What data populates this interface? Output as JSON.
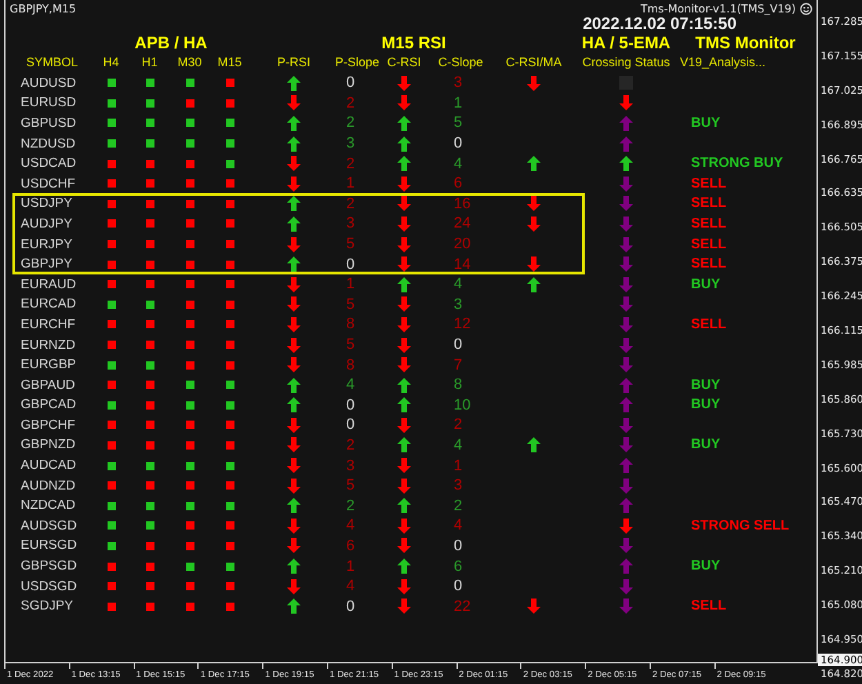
{
  "chart": {
    "symbol_timeframe": "GBPJPY,M15",
    "indicator": "Tms-Monitor-v1.1(TMS_V19)",
    "timestamp": "2022.12.02 07:15:50"
  },
  "group_headers": [
    {
      "label": "APB / HA",
      "kind": "apb"
    },
    {
      "label": "M15 RSI",
      "kind": "rsi"
    },
    {
      "label": "HA / 5-EMA",
      "kind": "ema"
    },
    {
      "label": "TMS Monitor",
      "kind": "tms"
    }
  ],
  "columns": [
    "SYMBOL",
    "H4",
    "H1",
    "M30",
    "M15",
    "P-RSI",
    "P-Slope",
    "C-RSI",
    "C-Slope",
    "C-RSI/MA",
    "Crossing Status",
    "V19_Analysis..."
  ],
  "rows": [
    {
      "symbol": "AUDUSD",
      "tf_up": [
        true,
        true,
        true,
        false
      ],
      "p_rsi_up": true,
      "p_slope": {
        "value": "0",
        "color": "#d8d8d8"
      },
      "c_rsi_up": false,
      "c_slope": {
        "value": "3",
        "color": "#b00000"
      },
      "c_rsi_ma": {
        "up": false
      },
      "crossing": {
        "kind": "box",
        "color": "#262626"
      },
      "highlighted": false
    },
    {
      "symbol": "EURUSD",
      "tf_up": [
        true,
        true,
        false,
        false
      ],
      "p_rsi_up": false,
      "p_slope": {
        "value": "2",
        "color": "#b00000"
      },
      "c_rsi_up": false,
      "c_slope": {
        "value": "1",
        "color": "#2a9a2a"
      },
      "crossing": {
        "kind": "arrow",
        "up": false,
        "color": "#ff0000"
      },
      "highlighted": false
    },
    {
      "symbol": "GBPUSD",
      "tf_up": [
        true,
        true,
        true,
        true
      ],
      "p_rsi_up": true,
      "p_slope": {
        "value": "2",
        "color": "#2a9a2a"
      },
      "c_rsi_up": true,
      "c_slope": {
        "value": "5",
        "color": "#2a9a2a"
      },
      "crossing": {
        "kind": "arrow",
        "up": true,
        "color": "#800080"
      },
      "signal": {
        "text": "BUY",
        "color": "#22c722"
      },
      "highlighted": false
    },
    {
      "symbol": "NZDUSD",
      "tf_up": [
        true,
        true,
        true,
        true
      ],
      "p_rsi_up": true,
      "p_slope": {
        "value": "3",
        "color": "#2a9a2a"
      },
      "c_rsi_up": true,
      "c_slope": {
        "value": "0",
        "color": "#d8d8d8"
      },
      "crossing": {
        "kind": "arrow",
        "up": true,
        "color": "#800080"
      },
      "highlighted": false
    },
    {
      "symbol": "USDCAD",
      "tf_up": [
        false,
        false,
        false,
        true
      ],
      "p_rsi_up": false,
      "p_slope": {
        "value": "2",
        "color": "#b00000"
      },
      "c_rsi_up": true,
      "c_slope": {
        "value": "4",
        "color": "#2a9a2a"
      },
      "c_rsi_ma": {
        "up": true
      },
      "crossing": {
        "kind": "arrow",
        "up": true,
        "color": "#22c722"
      },
      "signal": {
        "text": "STRONG BUY",
        "color": "#22c722"
      },
      "highlighted": false
    },
    {
      "symbol": "USDCHF",
      "tf_up": [
        false,
        false,
        false,
        false
      ],
      "p_rsi_up": false,
      "p_slope": {
        "value": "1",
        "color": "#b00000"
      },
      "c_rsi_up": false,
      "c_slope": {
        "value": "6",
        "color": "#b00000"
      },
      "crossing": {
        "kind": "arrow",
        "up": false,
        "color": "#800080"
      },
      "signal": {
        "text": "SELL",
        "color": "#ff0000"
      },
      "highlighted": false
    },
    {
      "symbol": "USDJPY",
      "tf_up": [
        false,
        false,
        false,
        false
      ],
      "p_rsi_up": true,
      "p_slope": {
        "value": "2",
        "color": "#b00000"
      },
      "c_rsi_up": false,
      "c_slope": {
        "value": "16",
        "color": "#b00000"
      },
      "c_rsi_ma": {
        "up": false
      },
      "crossing": {
        "kind": "arrow",
        "up": false,
        "color": "#800080"
      },
      "signal": {
        "text": "SELL",
        "color": "#ff0000"
      },
      "highlighted": true
    },
    {
      "symbol": "AUDJPY",
      "tf_up": [
        false,
        false,
        false,
        false
      ],
      "p_rsi_up": true,
      "p_slope": {
        "value": "3",
        "color": "#b00000"
      },
      "c_rsi_up": false,
      "c_slope": {
        "value": "24",
        "color": "#b00000"
      },
      "c_rsi_ma": {
        "up": false
      },
      "crossing": {
        "kind": "arrow",
        "up": false,
        "color": "#800080"
      },
      "signal": {
        "text": "SELL",
        "color": "#ff0000"
      },
      "highlighted": true
    },
    {
      "symbol": "EURJPY",
      "tf_up": [
        false,
        false,
        false,
        false
      ],
      "p_rsi_up": false,
      "p_slope": {
        "value": "5",
        "color": "#b00000"
      },
      "c_rsi_up": false,
      "c_slope": {
        "value": "20",
        "color": "#b00000"
      },
      "crossing": {
        "kind": "arrow",
        "up": false,
        "color": "#800080"
      },
      "signal": {
        "text": "SELL",
        "color": "#ff0000"
      },
      "highlighted": true
    },
    {
      "symbol": "GBPJPY",
      "tf_up": [
        false,
        false,
        false,
        false
      ],
      "p_rsi_up": true,
      "p_slope": {
        "value": "0",
        "color": "#d8d8d8"
      },
      "c_rsi_up": false,
      "c_slope": {
        "value": "14",
        "color": "#b00000"
      },
      "c_rsi_ma": {
        "up": false
      },
      "crossing": {
        "kind": "arrow",
        "up": false,
        "color": "#800080"
      },
      "signal": {
        "text": "SELL",
        "color": "#ff0000"
      },
      "highlighted": true
    },
    {
      "symbol": "EURAUD",
      "tf_up": [
        false,
        false,
        false,
        false
      ],
      "p_rsi_up": false,
      "p_slope": {
        "value": "1",
        "color": "#b00000"
      },
      "c_rsi_up": true,
      "c_slope": {
        "value": "4",
        "color": "#2a9a2a"
      },
      "c_rsi_ma": {
        "up": true
      },
      "crossing": {
        "kind": "arrow",
        "up": false,
        "color": "#800080"
      },
      "signal": {
        "text": "BUY",
        "color": "#22c722"
      },
      "highlighted": false
    },
    {
      "symbol": "EURCAD",
      "tf_up": [
        true,
        true,
        false,
        false
      ],
      "p_rsi_up": false,
      "p_slope": {
        "value": "5",
        "color": "#b00000"
      },
      "c_rsi_up": false,
      "c_slope": {
        "value": "3",
        "color": "#2a9a2a"
      },
      "crossing": {
        "kind": "arrow",
        "up": false,
        "color": "#800080"
      },
      "highlighted": false
    },
    {
      "symbol": "EURCHF",
      "tf_up": [
        false,
        false,
        false,
        false
      ],
      "p_rsi_up": false,
      "p_slope": {
        "value": "8",
        "color": "#b00000"
      },
      "c_rsi_up": false,
      "c_slope": {
        "value": "12",
        "color": "#b00000"
      },
      "crossing": {
        "kind": "arrow",
        "up": false,
        "color": "#800080"
      },
      "signal": {
        "text": "SELL",
        "color": "#ff0000"
      },
      "highlighted": false
    },
    {
      "symbol": "EURNZD",
      "tf_up": [
        false,
        false,
        false,
        false
      ],
      "p_rsi_up": false,
      "p_slope": {
        "value": "5",
        "color": "#b00000"
      },
      "c_rsi_up": false,
      "c_slope": {
        "value": "0",
        "color": "#d8d8d8"
      },
      "crossing": {
        "kind": "arrow",
        "up": false,
        "color": "#800080"
      },
      "highlighted": false
    },
    {
      "symbol": "EURGBP",
      "tf_up": [
        true,
        true,
        false,
        false
      ],
      "p_rsi_up": false,
      "p_slope": {
        "value": "8",
        "color": "#b00000"
      },
      "c_rsi_up": false,
      "c_slope": {
        "value": "7",
        "color": "#b00000"
      },
      "crossing": {
        "kind": "arrow",
        "up": false,
        "color": "#800080"
      },
      "highlighted": false
    },
    {
      "symbol": "GBPAUD",
      "tf_up": [
        false,
        false,
        true,
        true
      ],
      "p_rsi_up": true,
      "p_slope": {
        "value": "4",
        "color": "#2a9a2a"
      },
      "c_rsi_up": true,
      "c_slope": {
        "value": "8",
        "color": "#2a9a2a"
      },
      "crossing": {
        "kind": "arrow",
        "up": true,
        "color": "#800080"
      },
      "signal": {
        "text": "BUY",
        "color": "#22c722"
      },
      "highlighted": false
    },
    {
      "symbol": "GBPCAD",
      "tf_up": [
        true,
        false,
        true,
        true
      ],
      "p_rsi_up": true,
      "p_slope": {
        "value": "0",
        "color": "#d8d8d8"
      },
      "c_rsi_up": true,
      "c_slope": {
        "value": "10",
        "color": "#2a9a2a"
      },
      "crossing": {
        "kind": "arrow",
        "up": true,
        "color": "#800080"
      },
      "signal": {
        "text": "BUY",
        "color": "#22c722"
      },
      "highlighted": false
    },
    {
      "symbol": "GBPCHF",
      "tf_up": [
        false,
        false,
        false,
        false
      ],
      "p_rsi_up": false,
      "p_slope": {
        "value": "0",
        "color": "#d8d8d8"
      },
      "c_rsi_up": false,
      "c_slope": {
        "value": "2",
        "color": "#b00000"
      },
      "crossing": {
        "kind": "arrow",
        "up": false,
        "color": "#800080"
      },
      "highlighted": false
    },
    {
      "symbol": "GBPNZD",
      "tf_up": [
        false,
        false,
        false,
        false
      ],
      "p_rsi_up": false,
      "p_slope": {
        "value": "2",
        "color": "#b00000"
      },
      "c_rsi_up": true,
      "c_slope": {
        "value": "4",
        "color": "#2a9a2a"
      },
      "c_rsi_ma": {
        "up": true
      },
      "crossing": {
        "kind": "arrow",
        "up": false,
        "color": "#800080"
      },
      "signal": {
        "text": "BUY",
        "color": "#22c722"
      },
      "highlighted": false
    },
    {
      "symbol": "AUDCAD",
      "tf_up": [
        true,
        true,
        true,
        true
      ],
      "p_rsi_up": false,
      "p_slope": {
        "value": "3",
        "color": "#b00000"
      },
      "c_rsi_up": false,
      "c_slope": {
        "value": "1",
        "color": "#b00000"
      },
      "crossing": {
        "kind": "arrow",
        "up": true,
        "color": "#800080"
      },
      "highlighted": false
    },
    {
      "symbol": "AUDNZD",
      "tf_up": [
        false,
        false,
        false,
        false
      ],
      "p_rsi_up": false,
      "p_slope": {
        "value": "5",
        "color": "#b00000"
      },
      "c_rsi_up": false,
      "c_slope": {
        "value": "3",
        "color": "#b00000"
      },
      "crossing": {
        "kind": "arrow",
        "up": false,
        "color": "#800080"
      },
      "highlighted": false
    },
    {
      "symbol": "NZDCAD",
      "tf_up": [
        true,
        true,
        true,
        true
      ],
      "p_rsi_up": true,
      "p_slope": {
        "value": "2",
        "color": "#2a9a2a"
      },
      "c_rsi_up": true,
      "c_slope": {
        "value": "2",
        "color": "#2a9a2a"
      },
      "crossing": {
        "kind": "arrow",
        "up": true,
        "color": "#800080"
      },
      "highlighted": false
    },
    {
      "symbol": "AUDSGD",
      "tf_up": [
        true,
        true,
        false,
        false
      ],
      "p_rsi_up": false,
      "p_slope": {
        "value": "4",
        "color": "#b00000"
      },
      "c_rsi_up": false,
      "c_slope": {
        "value": "4",
        "color": "#b00000"
      },
      "crossing": {
        "kind": "arrow",
        "up": false,
        "color": "#ff0000"
      },
      "signal": {
        "text": "STRONG SELL",
        "color": "#ff0000"
      },
      "highlighted": false
    },
    {
      "symbol": "EURSGD",
      "tf_up": [
        true,
        false,
        false,
        false
      ],
      "p_rsi_up": false,
      "p_slope": {
        "value": "6",
        "color": "#b00000"
      },
      "c_rsi_up": false,
      "c_slope": {
        "value": "0",
        "color": "#d8d8d8"
      },
      "crossing": {
        "kind": "arrow",
        "up": false,
        "color": "#800080"
      },
      "highlighted": false
    },
    {
      "symbol": "GBPSGD",
      "tf_up": [
        false,
        false,
        true,
        true
      ],
      "p_rsi_up": true,
      "p_slope": {
        "value": "1",
        "color": "#b00000"
      },
      "c_rsi_up": true,
      "c_slope": {
        "value": "6",
        "color": "#2a9a2a"
      },
      "crossing": {
        "kind": "arrow",
        "up": true,
        "color": "#800080"
      },
      "signal": {
        "text": "BUY",
        "color": "#22c722"
      },
      "highlighted": false
    },
    {
      "symbol": "USDSGD",
      "tf_up": [
        false,
        false,
        false,
        false
      ],
      "p_rsi_up": false,
      "p_slope": {
        "value": "4",
        "color": "#b00000"
      },
      "c_rsi_up": false,
      "c_slope": {
        "value": "0",
        "color": "#d8d8d8"
      },
      "crossing": {
        "kind": "arrow",
        "up": false,
        "color": "#800080"
      },
      "highlighted": false
    },
    {
      "symbol": "SGDJPY",
      "tf_up": [
        false,
        false,
        false,
        false
      ],
      "p_rsi_up": true,
      "p_slope": {
        "value": "0",
        "color": "#d8d8d8"
      },
      "c_rsi_up": false,
      "c_slope": {
        "value": "22",
        "color": "#b00000"
      },
      "c_rsi_ma": {
        "up": false
      },
      "crossing": {
        "kind": "arrow",
        "up": false,
        "color": "#800080"
      },
      "signal": {
        "text": "SELL",
        "color": "#ff0000"
      },
      "highlighted": false
    }
  ],
  "price_axis": {
    "labels": [
      "167.285",
      "167.155",
      "167.025",
      "166.895",
      "166.765",
      "166.635",
      "166.505",
      "166.375",
      "166.245",
      "166.115",
      "165.985",
      "165.860",
      "165.730",
      "165.600",
      "165.470",
      "165.340",
      "165.210",
      "165.080",
      "164.950",
      "164.820"
    ],
    "current": "164.900"
  },
  "time_axis": [
    "1 Dec 2022",
    "1 Dec 13:15",
    "1 Dec 15:15",
    "1 Dec 17:15",
    "1 Dec 19:15",
    "1 Dec 21:15",
    "1 Dec 23:15",
    "2 Dec 01:15",
    "2 Dec 03:15",
    "2 Dec 05:15",
    "2 Dec 07:15",
    "2 Dec 09:15"
  ]
}
